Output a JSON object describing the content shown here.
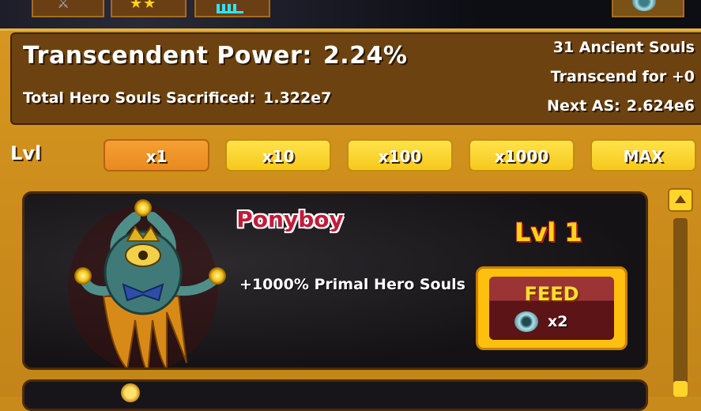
{
  "topbar": {
    "tabs": [
      {
        "icon": "sword-icon"
      },
      {
        "icon": "stars-icon"
      },
      {
        "icon": "bar-chart-icon"
      },
      {
        "icon": "ancient-soul-icon"
      }
    ]
  },
  "info": {
    "transcendent_power_label": "Transcendent Power:",
    "transcendent_power_value": "2.24%",
    "souls_sacrificed_label": "Total Hero Souls Sacrificed:",
    "souls_sacrificed_value": "1.322e7",
    "ancient_souls": "31 Ancient Souls",
    "transcend_for": "Transcend for +0",
    "next_as_label": "Next AS:",
    "next_as_value": "2.624e6"
  },
  "multiplier": {
    "label": "Lvl",
    "buttons": [
      "x1",
      "x10",
      "x100",
      "x1000",
      "MAX"
    ],
    "selected": "x1"
  },
  "outsider": {
    "name": "Ponyboy",
    "level": "Lvl 1",
    "description": "+1000% Primal Hero Souls",
    "feed_label": "FEED",
    "feed_cost": "x2",
    "feed_cost_icon": "ancient-soul-icon"
  },
  "colors": {
    "frame": "#c98a1c",
    "panel": "#6c4310",
    "active_button": "#f5a032",
    "button": "#ffe34a",
    "name": "#c41a3a",
    "level": "#ffd316"
  }
}
